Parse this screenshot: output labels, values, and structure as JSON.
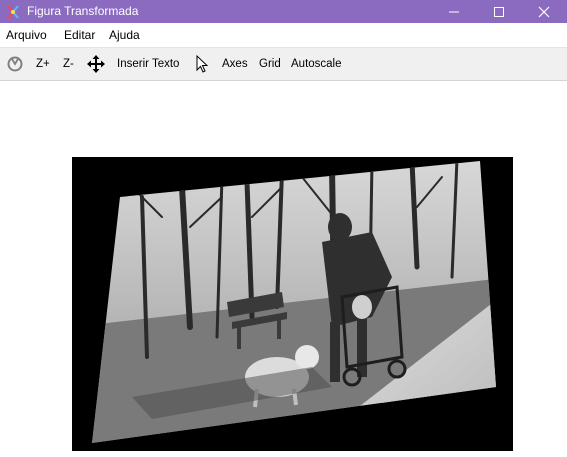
{
  "window": {
    "title": "Figura Transformada",
    "title_bg": "#8b6bbf",
    "buttons": [
      "minimize-icon",
      "maximize-icon",
      "close-icon"
    ]
  },
  "menu": {
    "items": [
      "Arquivo",
      "Editar",
      "Ajuda"
    ]
  },
  "toolbar": {
    "home_icon": "home-reset-icon",
    "zoom_in_label": "Z+",
    "zoom_out_label": "Z-",
    "pan_icon": "move-arrows-icon",
    "insert_text_label": "Inserir Texto",
    "cursor_icon": "pointer-icon",
    "axes_label": "Axes",
    "grid_label": "Grid",
    "autoscale_label": "Autoscale"
  },
  "figure": {
    "background": "#000000",
    "content": "rotated grayscale photograph"
  }
}
